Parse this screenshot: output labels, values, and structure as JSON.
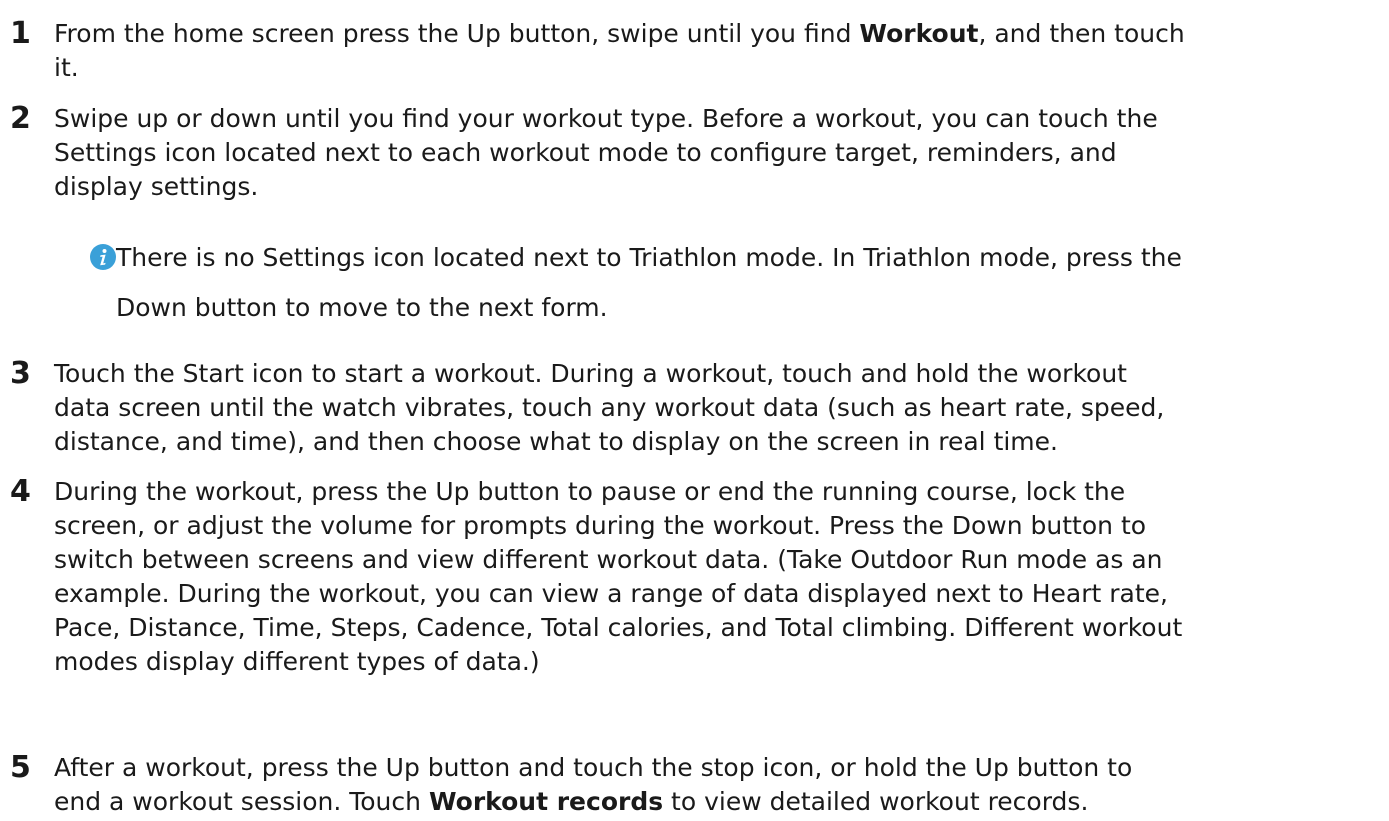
{
  "steps": [
    {
      "number": "1",
      "lines": [
        {
          "parts": [
            "From the home screen press the Up button, swipe until you find ",
            "Workout",
            ", and then touch"
          ]
        },
        "it."
      ]
    },
    {
      "number": "2",
      "lines": [
        "Swipe up or down until you find your workout type. Before a workout, you can touch the",
        "Settings icon located next to each workout mode to configure target, reminders, and",
        "display settings."
      ]
    },
    {
      "number": "3",
      "lines": [
        "Touch the Start icon to start a workout. During a workout, touch and hold the workout",
        "data screen until the watch vibrates, touch any workout data (such as heart rate, speed,",
        "distance, and time), and then choose what to display on the screen in real time."
      ]
    },
    {
      "number": "4",
      "lines": [
        "During the workout, press the Up button to pause or end the running course, lock the",
        "screen, or adjust the volume for prompts during the workout. Press the Down button to",
        "switch between screens and view different workout data. (Take Outdoor Run mode as an",
        "example. During the workout, you can view a range of data displayed next to Heart rate,",
        "Pace, Distance, Time, Steps, Cadence, Total calories, and Total climbing. Different workout",
        "modes display different types of data.)"
      ]
    },
    {
      "number": "5",
      "lines": [
        "After a workout, press the Up button and touch the stop icon, or hold the Up button to",
        {
          "parts": [
            "end a workout session. Touch ",
            "Workout records",
            " to view detailed workout records."
          ]
        }
      ]
    }
  ],
  "note": {
    "icon": "info-icon",
    "icon_color": "#3aa0d8",
    "line1": "There is no Settings icon located next to Triathlon mode. In Triathlon mode, press the",
    "line2": "Down button to move to the next form."
  }
}
